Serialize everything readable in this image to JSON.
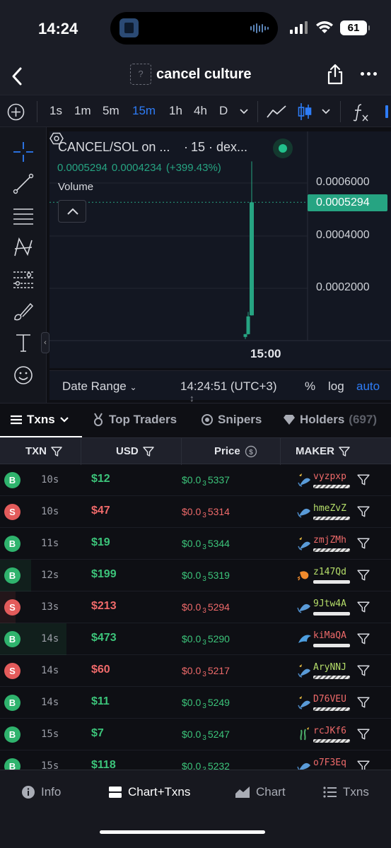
{
  "status": {
    "time": "14:24",
    "battery": "61"
  },
  "header": {
    "title": "cancel culture",
    "token_placeholder": "?"
  },
  "toolbar": {
    "timeframes": [
      {
        "label": "1s",
        "active": false
      },
      {
        "label": "1m",
        "active": false
      },
      {
        "label": "5m",
        "active": false
      },
      {
        "label": "15m",
        "active": true
      },
      {
        "label": "1h",
        "active": false
      },
      {
        "label": "4h",
        "active": false
      },
      {
        "label": "D",
        "active": false
      }
    ]
  },
  "chart": {
    "legend_title": "CANCEL/SOL on ...",
    "legend_sep": "·",
    "legend_tf": "15 · dex...",
    "legend_values": [
      "0.0005294",
      "0.0004234",
      "(+399.43%)"
    ],
    "volume_label": "Volume",
    "current_price": "0.0005294",
    "y_ticks": [
      "0.0006000",
      "0.0004000",
      "0.0002000"
    ],
    "time_label": "15:00",
    "footer": {
      "date_range": "Date Range",
      "clock": "14:24:51 (UTC+3)",
      "percent": "%",
      "log": "log",
      "auto": "auto"
    }
  },
  "chart_data": {
    "type": "candlestick",
    "title": "CANCEL/SOL on ...",
    "y_ticks": [
      0.0006,
      0.0004,
      0.0002
    ],
    "last_price": 0.0005294,
    "change": "+399.43%",
    "candles": [
      {
        "open": 1.8e-05,
        "close": 2.85e-05,
        "high": 2.95e-05,
        "low": 1e-05
      },
      {
        "open": 2.85e-05,
        "close": 9.6e-05,
        "high": 0.000113,
        "low": 2.75e-05
      },
      {
        "open": 0.0001,
        "close": 0.0005294,
        "high": 0.000685,
        "low": 9.9e-05
      }
    ]
  },
  "tabs": [
    {
      "label": "Txns",
      "active": true
    },
    {
      "label": "Top Traders",
      "active": false
    },
    {
      "label": "Snipers",
      "active": false
    },
    {
      "label": "Holders",
      "active": false,
      "count": "(697)"
    }
  ],
  "table": {
    "headers": {
      "txn": "TXN",
      "usd": "USD",
      "price": "Price",
      "maker": "MAKER"
    },
    "rows": [
      {
        "type": "B",
        "age": "10s",
        "usd": "$12",
        "price_pre": "$0.0",
        "price_sub": "3",
        "price_post": "5337",
        "maker": "vyzpxp",
        "maker_color": "#ef6a6a",
        "icon": "sparkle-fish-icon",
        "bar": "striped",
        "bar_pct": 0
      },
      {
        "type": "S",
        "age": "10s",
        "usd": "$47",
        "price_pre": "$0.0",
        "price_sub": "3",
        "price_post": "5314",
        "maker": "hmeZvZ",
        "maker_color": "#b6df6a",
        "icon": "fish-icon",
        "bar": "striped",
        "bar_pct": 0
      },
      {
        "type": "B",
        "age": "11s",
        "usd": "$19",
        "price_pre": "$0.0",
        "price_sub": "3",
        "price_post": "5344",
        "maker": "zmjZMh",
        "maker_color": "#ef6a6a",
        "icon": "sparkle-fish-icon",
        "bar": "striped",
        "bar_pct": 0
      },
      {
        "type": "B",
        "age": "12s",
        "usd": "$199",
        "price_pre": "$0.0",
        "price_sub": "3",
        "price_post": "5319",
        "maker": "z147Qd",
        "maker_color": "#b6df6a",
        "icon": "shrimp-icon",
        "bar": "solid",
        "bar_pct": 8
      },
      {
        "type": "S",
        "age": "13s",
        "usd": "$213",
        "price_pre": "$0.0",
        "price_sub": "3",
        "price_post": "5294",
        "maker": "9Jtw4A",
        "maker_color": "#b6df6a",
        "icon": "fish-icon",
        "bar": "solid",
        "bar_pct": 4
      },
      {
        "type": "B",
        "age": "14s",
        "usd": "$473",
        "price_pre": "$0.0",
        "price_sub": "3",
        "price_post": "5290",
        "maker": "kiMaQA",
        "maker_color": "#ef6a6a",
        "icon": "dolphin-icon",
        "bar": "solid",
        "bar_pct": 17
      },
      {
        "type": "S",
        "age": "14s",
        "usd": "$60",
        "price_pre": "$0.0",
        "price_sub": "3",
        "price_post": "5217",
        "maker": "AryNNJ",
        "maker_color": "#b6df6a",
        "icon": "sparkle-fish-icon",
        "bar": "striped",
        "bar_pct": 0
      },
      {
        "type": "B",
        "age": "14s",
        "usd": "$11",
        "price_pre": "$0.0",
        "price_sub": "3",
        "price_post": "5249",
        "maker": "D76VEU",
        "maker_color": "#ef6a6a",
        "icon": "sparkle-fish-icon",
        "bar": "striped",
        "bar_pct": 0
      },
      {
        "type": "B",
        "age": "15s",
        "usd": "$7",
        "price_pre": "$0.0",
        "price_sub": "3",
        "price_post": "5247",
        "maker": "rcJKf6",
        "maker_color": "#ef6a6a",
        "icon": "sparkle-seaweed-icon",
        "bar": "striped",
        "bar_pct": 0
      },
      {
        "type": "B",
        "age": "15s",
        "usd": "$118",
        "price_pre": "$0.0",
        "price_sub": "3",
        "price_post": "5232",
        "maker": "o7F3Eq",
        "maker_color": "#ef6a6a",
        "icon": "fish-icon",
        "bar": "solid",
        "bar_pct": 0
      }
    ]
  },
  "nav": [
    {
      "label": "Info",
      "icon": "info-icon",
      "active": false
    },
    {
      "label": "Chart+Txns",
      "icon": "split-icon",
      "active": true
    },
    {
      "label": "Chart",
      "icon": "chart-icon",
      "active": false
    },
    {
      "label": "Txns",
      "icon": "list-icon",
      "active": false
    }
  ],
  "colors": {
    "buy": "#3cc47a",
    "sell": "#ef6a6a",
    "accent": "#2e7cf6",
    "candle_up": "#26a482"
  }
}
